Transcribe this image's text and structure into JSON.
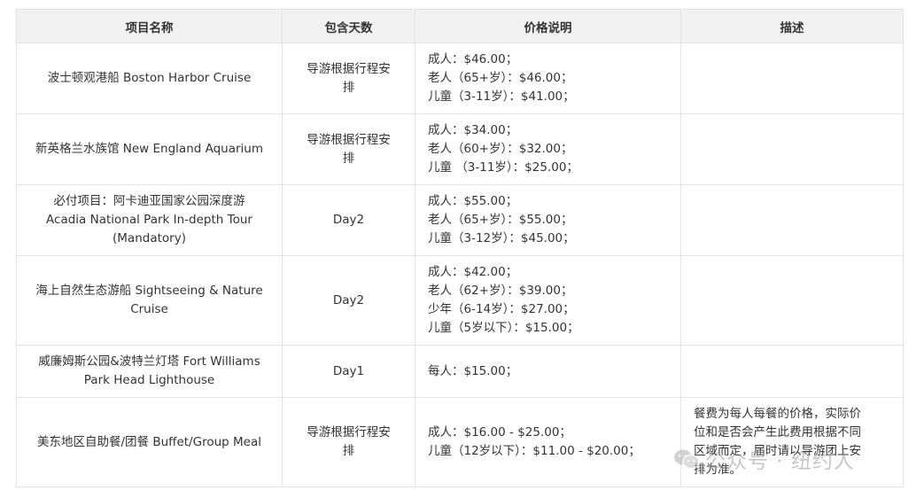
{
  "headers": [
    "项目名称",
    "包含天数",
    "价格说明",
    "描述"
  ],
  "rows": [
    {
      "name": [
        "波士顿观港船 Boston Harbor Cruise"
      ],
      "days": [
        "导游根据行程安",
        "排"
      ],
      "prices": [
        "成人：$46.00；",
        "老人（65+岁）：$46.00；",
        "儿童（3-11岁）：$41.00；"
      ],
      "desc": []
    },
    {
      "name": [
        "新英格兰水族馆 New England Aquarium"
      ],
      "days": [
        "导游根据行程安",
        "排"
      ],
      "prices": [
        "成人：$34.00；",
        "老人（60+岁）：$32.00；",
        "儿童 （3-11岁）：$25.00；"
      ],
      "desc": []
    },
    {
      "name": [
        "必付项目：阿卡迪亚国家公园深度游",
        "Acadia National Park In-depth Tour",
        "(Mandatory)"
      ],
      "days": [
        "Day2"
      ],
      "prices": [
        "成人：$55.00；",
        "老人（65+岁）：$55.00；",
        "儿童（3-12岁）：$45.00；"
      ],
      "desc": []
    },
    {
      "name": [
        "海上自然生态游船 Sightseeing & Nature",
        "Cruise"
      ],
      "days": [
        "Day2"
      ],
      "prices": [
        "成人：$42.00；",
        "老人（62+岁）：$39.00；",
        "少年（6-14岁）：$27.00；",
        "儿童（5岁以下）：$15.00；"
      ],
      "desc": []
    },
    {
      "name": [
        "威廉姆斯公园&波特兰灯塔 Fort Williams",
        "Park Head Lighthouse"
      ],
      "days": [
        "Day1"
      ],
      "prices": [
        "每人：$15.00；"
      ],
      "desc": []
    },
    {
      "name": [
        "美东地区自助餐/团餐 Buffet/Group Meal"
      ],
      "days": [
        "导游根据行程安",
        "排"
      ],
      "prices": [
        "成人：$16.00 - $25.00；",
        "儿童（12岁以下）：$11.00 - $20.00；"
      ],
      "desc": [
        "餐费为每人每餐的价格，实际价",
        "位和是否会产生此费用根据不同",
        "区域而定，届时请以导游团上安",
        "排为准。"
      ]
    }
  ],
  "watermark": {
    "icon": "wechat-icon",
    "text": "公众号 · 纽约人"
  }
}
